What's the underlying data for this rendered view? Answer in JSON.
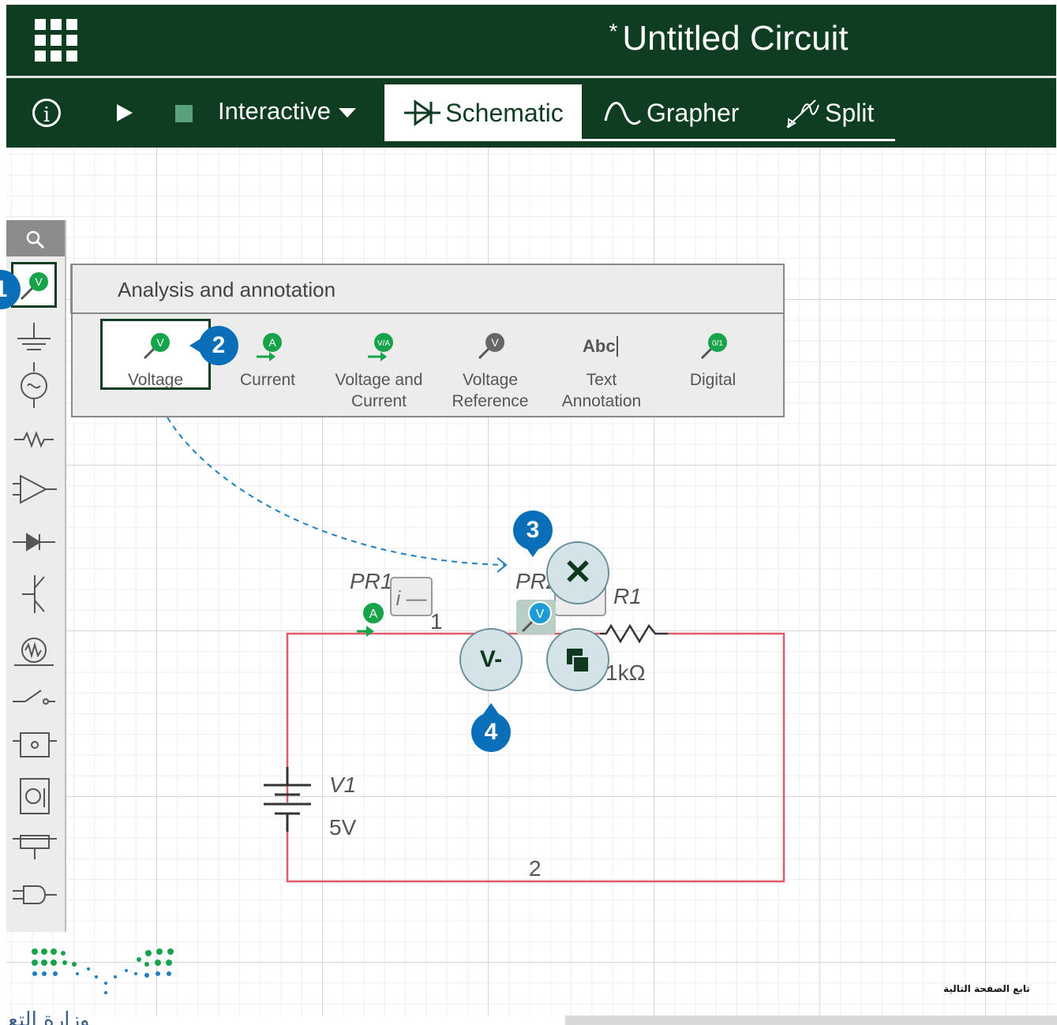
{
  "window": {
    "title": "Untitled Circuit",
    "modified_marker": "*"
  },
  "toolbar": {
    "mode_label": "Interactive",
    "tabs": [
      {
        "label": "Schematic",
        "active": true
      },
      {
        "label": "Grapher",
        "active": false
      },
      {
        "label": "Split",
        "active": false
      }
    ]
  },
  "popup": {
    "title": "Analysis and annotation",
    "options": [
      {
        "label": "Voltage",
        "icon": "voltage-probe-icon",
        "glyph": "V",
        "selected": true
      },
      {
        "label": "Current",
        "icon": "current-probe-icon",
        "glyph": "A"
      },
      {
        "label": "Voltage and Current",
        "icon": "voltage-current-probe-icon",
        "glyph": "V/A"
      },
      {
        "label": "Voltage Reference",
        "icon": "voltage-reference-probe-icon",
        "glyph": "V"
      },
      {
        "label": "Text Annotation",
        "icon": "text-annotation-icon",
        "glyph": "Abc"
      },
      {
        "label": "Digital",
        "icon": "digital-probe-icon",
        "glyph": "0/1"
      }
    ]
  },
  "palette": {
    "selected_glyph": "V"
  },
  "circuit": {
    "probe1_label": "PR1",
    "probe1_glyph": "A",
    "probe1_value": "i —",
    "probe2_label": "PR2",
    "probe2_glyph": "V",
    "node1": "1",
    "node2": "2",
    "resistor_name": "R1",
    "resistor_value": "1kΩ",
    "source_name": "V1",
    "source_value": "5V"
  },
  "context_menu": {
    "delete_glyph": "✕",
    "toggle_label": "V-"
  },
  "badges": [
    "1",
    "2",
    "3",
    "4"
  ],
  "footer": {
    "note": "تابع الصفحة التالية",
    "fragment": "وزارة التع"
  },
  "colors": {
    "brand_dark_green": "#0f3d22",
    "probe_green": "#17a34a",
    "probe_blue": "#1e9bd7",
    "wire_red": "#e05a6a",
    "badge_blue": "#0a6fb8"
  }
}
